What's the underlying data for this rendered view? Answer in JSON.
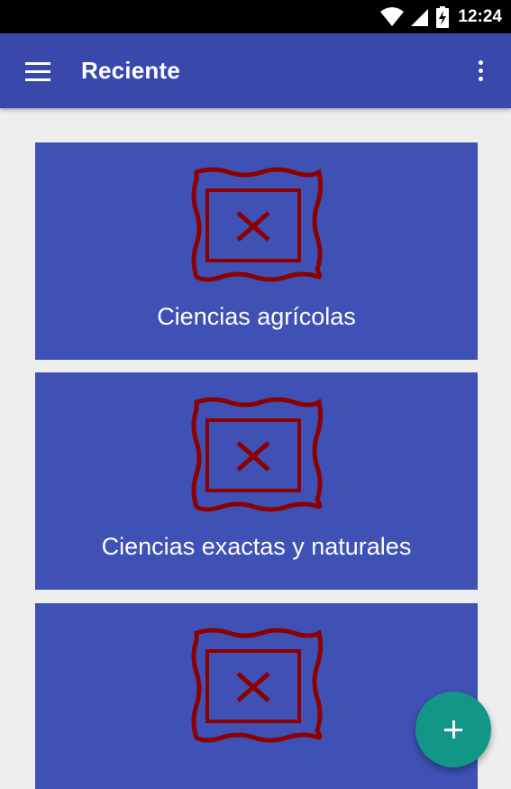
{
  "status_bar": {
    "time": "12:24",
    "icons": [
      "wifi-icon",
      "signal-icon",
      "battery-charging-icon"
    ]
  },
  "app_bar": {
    "title": "Reciente",
    "menu_icon": "menu-icon",
    "overflow_icon": "more-vert-icon"
  },
  "cards": [
    {
      "label": "Ciencias agrícolas",
      "image": "broken-image-icon"
    },
    {
      "label": "Ciencias exactas y naturales",
      "image": "broken-image-icon"
    },
    {
      "label": "",
      "image": "broken-image-icon"
    }
  ],
  "fab": {
    "icon": "add-icon"
  },
  "colors": {
    "primary": "#3f51b5",
    "primary_dark": "#3949ab",
    "accent": "#129688",
    "image_placeholder": "#8b0000",
    "background": "#eeeeee"
  }
}
